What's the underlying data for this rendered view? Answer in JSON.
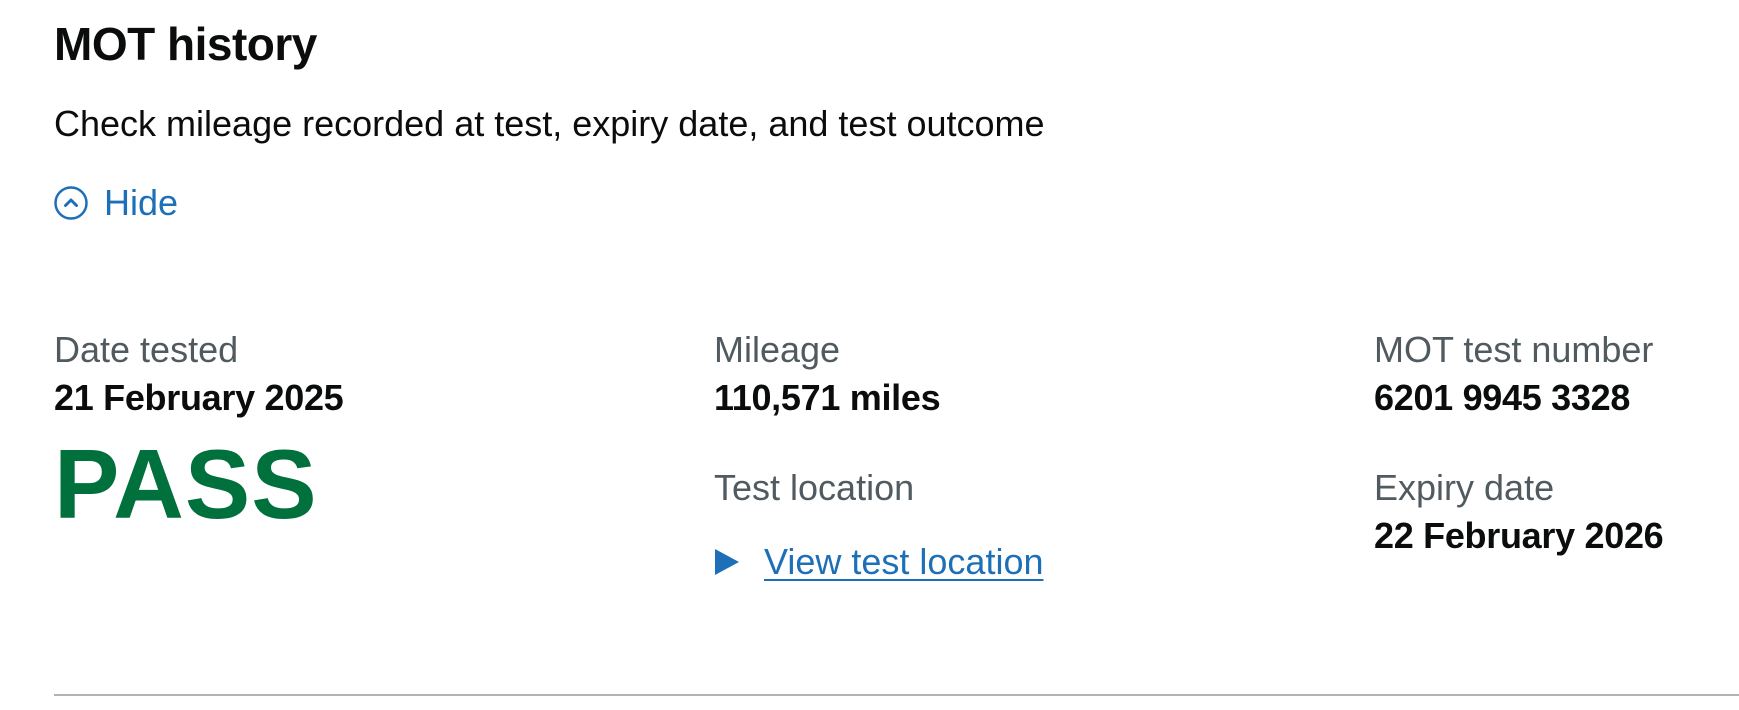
{
  "section": {
    "title": "MOT history",
    "description": "Check mileage recorded at test, expiry date, and test outcome",
    "toggle_label": "Hide"
  },
  "test": {
    "date_label": "Date tested",
    "date_value": "21 February 2025",
    "result": "PASS",
    "mileage_label": "Mileage",
    "mileage_value": "110,571 miles",
    "location_label": "Test location",
    "location_link": "View test location",
    "number_label": "MOT test number",
    "number_value": "6201 9945 3328",
    "expiry_label": "Expiry date",
    "expiry_value": "22 February 2026"
  },
  "colors": {
    "link": "#1d70b8",
    "pass": "#00703c",
    "secondary_text": "#505a5f",
    "divider": "#b1b4b6"
  },
  "icons": {
    "toggle": "chevron-up-circle-icon",
    "details": "triangle-right-icon"
  }
}
